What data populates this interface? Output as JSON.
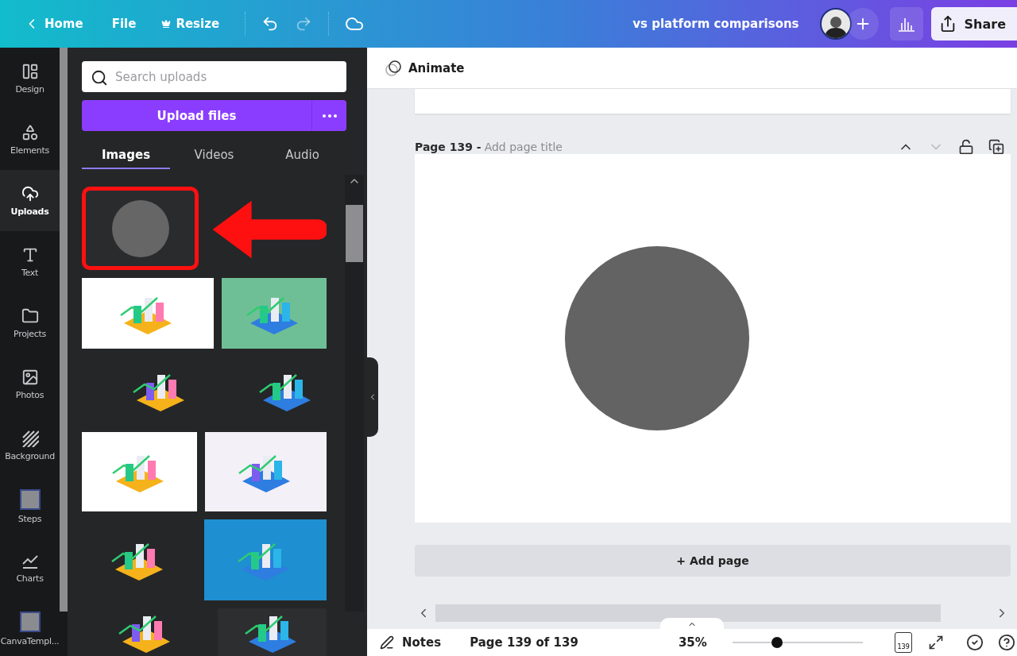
{
  "topbar": {
    "back": "Home",
    "menus": [
      "File",
      "Resize"
    ],
    "redo_disabled": true,
    "title": "vs platform comparisons",
    "share": "Share"
  },
  "rail": [
    {
      "label": "Design",
      "kind": "design",
      "selected": false
    },
    {
      "label": "Elements",
      "kind": "elements",
      "selected": false
    },
    {
      "label": "Uploads",
      "kind": "uploads",
      "selected": true
    },
    {
      "label": "Text",
      "kind": "text",
      "selected": false
    },
    {
      "label": "Projects",
      "kind": "projects",
      "selected": false
    },
    {
      "label": "Photos",
      "kind": "photos",
      "selected": false
    },
    {
      "label": "Background",
      "kind": "background",
      "selected": false
    },
    {
      "label": "Steps",
      "kind": "thumb",
      "selected": false
    },
    {
      "label": "Charts",
      "kind": "charts",
      "selected": false
    },
    {
      "label": "CanvaTempl...",
      "kind": "thumb",
      "selected": false
    }
  ],
  "panel": {
    "search": {
      "placeholder": "Search uploads"
    },
    "upload": "Upload files",
    "tabs": [
      {
        "label": "Images",
        "selected": true
      },
      {
        "label": "Videos",
        "selected": false
      },
      {
        "label": "Audio",
        "selected": false
      }
    ],
    "images": [
      {
        "color": "#2a2b2d",
        "highlighted": true
      },
      {
        "color": "#ffffff",
        "highlighted": false
      },
      {
        "color": "#6fbf96",
        "highlighted": false
      },
      {
        "color": "#252627",
        "highlighted": false
      },
      {
        "color": "#252627",
        "highlighted": false
      },
      {
        "color": "#ffffff",
        "highlighted": false
      },
      {
        "color": "#f4f0f8",
        "highlighted": false
      },
      {
        "color": "#252627",
        "highlighted": false
      },
      {
        "color": "#1e8fd0",
        "highlighted": false
      },
      {
        "color": "#252627",
        "highlighted": false
      },
      {
        "color": "#2d2e30",
        "highlighted": false
      }
    ]
  },
  "editor": {
    "animate": "Animate",
    "page_label": "Page 139 -",
    "page_title_placeholder": "Add page title",
    "add_page": "+ Add page"
  },
  "footer": {
    "notes": "Notes",
    "page_count": "Page 139 of 139",
    "zoom": "35%",
    "level": 0.34,
    "pages_badge": "139"
  }
}
